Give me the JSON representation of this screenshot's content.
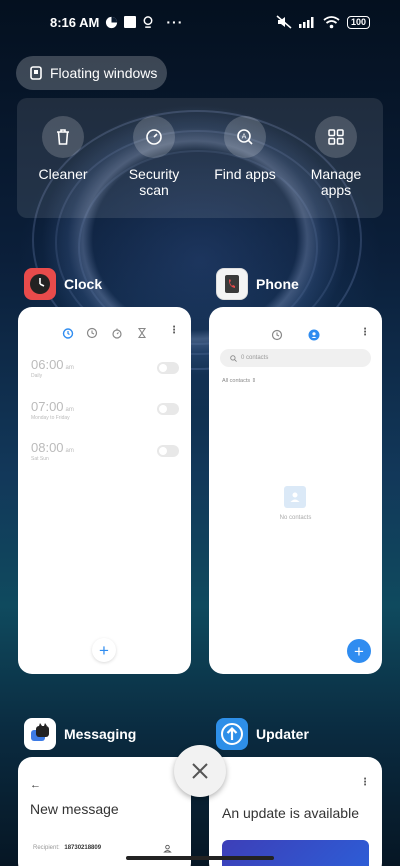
{
  "status_bar": {
    "time": "8:16 AM",
    "battery": "100",
    "icons": [
      "data-saver-icon",
      "stop-icon",
      "location-icon",
      "more-icon",
      "mute-icon",
      "signal-icon",
      "wifi-icon",
      "battery-icon"
    ]
  },
  "floating_windows": {
    "label": "Floating windows"
  },
  "tools": [
    {
      "label": "Cleaner",
      "icon": "trash-icon"
    },
    {
      "label": "Security\nscan",
      "icon": "shield-check-icon"
    },
    {
      "label": "Find apps",
      "icon": "find-apps-icon"
    },
    {
      "label": "Manage\napps",
      "icon": "grid-icon"
    }
  ],
  "apps": {
    "clock": {
      "name": "Clock",
      "alarms": [
        {
          "time": "06:00",
          "ampm": "am",
          "days": "Daily"
        },
        {
          "time": "07:00",
          "ampm": "am",
          "days": "Monday to Friday"
        },
        {
          "time": "08:00",
          "ampm": "am",
          "days": "Sat Sun"
        }
      ],
      "fab": "+"
    },
    "phone": {
      "name": "Phone",
      "search_placeholder": "0 contacts",
      "filter": "All contacts",
      "empty_text": "No contacts",
      "fab": "+"
    },
    "messaging": {
      "name": "Messaging",
      "title": "New message",
      "recipient_label": "Recipient:",
      "recipient_value": "18730218809"
    },
    "updater": {
      "name": "Updater",
      "title": "An update is available"
    }
  },
  "colors": {
    "accent_blue": "#2f8cf0",
    "clock_icon_bg": "#e84b4b",
    "updater_icon_bg": "#2e8fe8"
  }
}
